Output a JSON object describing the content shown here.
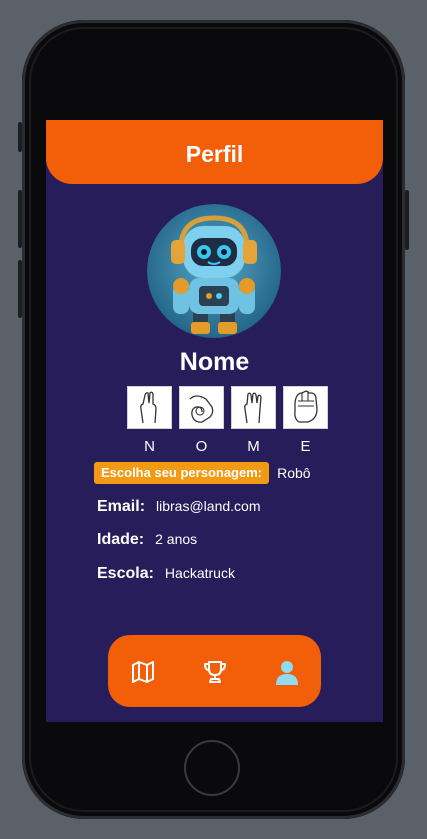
{
  "header": {
    "title": "Perfil"
  },
  "profile": {
    "name": "Nome",
    "sign_letters": [
      "N",
      "O",
      "M",
      "E"
    ],
    "character_button": "Escolha seu personagem:",
    "character_value": "Robô",
    "email_label": "Email:",
    "email_value": "libras@land.com",
    "age_label": "Idade:",
    "age_value": "2 anos",
    "school_label": "Escola:",
    "school_value": "Hackatruck"
  },
  "tabbar": {
    "tabs": [
      {
        "icon": "map-icon",
        "active": false
      },
      {
        "icon": "trophy-icon",
        "active": false
      },
      {
        "icon": "person-icon",
        "active": true
      }
    ]
  },
  "colors": {
    "accent": "#f25f08",
    "background": "#271d5b",
    "button": "#f39a14",
    "active_tab": "#8fdcf0"
  }
}
